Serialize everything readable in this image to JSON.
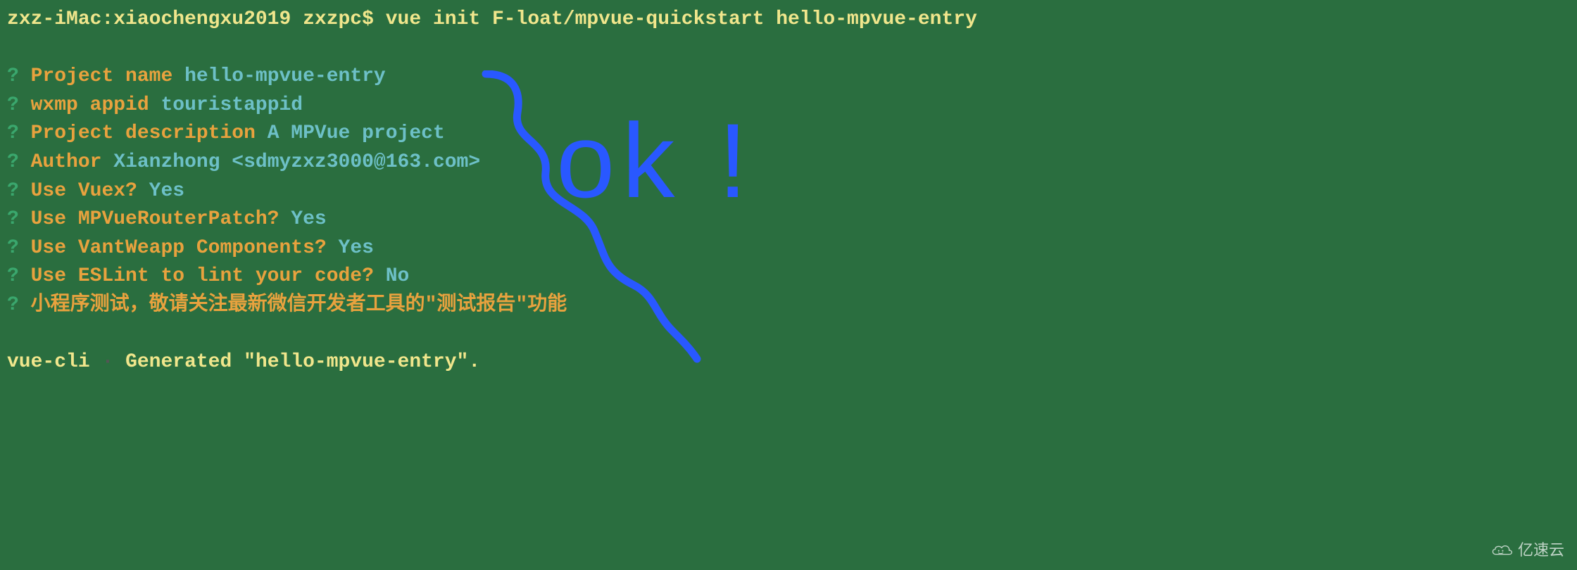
{
  "command": {
    "host": "zxz-iMac",
    "dir": "xiaochengxu2019",
    "user": "zxzpc",
    "symbol": "$",
    "text": "vue init F-loat/mpvue-quickstart hello-mpvue-entry"
  },
  "prompts": [
    {
      "label": "Project name",
      "value": "hello-mpvue-entry"
    },
    {
      "label": "wxmp appid",
      "value": "touristappid"
    },
    {
      "label": "Project description",
      "value": "A MPVue project"
    },
    {
      "label": "Author",
      "value": "Xianzhong <sdmyzxz3000@163.com>"
    },
    {
      "label": "Use Vuex?",
      "value": "Yes"
    },
    {
      "label": "Use MPVueRouterPatch?",
      "value": "Yes"
    },
    {
      "label": "Use VantWeapp Components?",
      "value": "Yes"
    },
    {
      "label": "Use ESLint to lint your code?",
      "value": "No"
    },
    {
      "label": "小程序测试，敬请关注最新微信开发者工具的\"测试报告\"功能",
      "value": ""
    }
  ],
  "result": {
    "tool": "vue-cli",
    "message": "Generated \"hello-mpvue-entry\"."
  },
  "annotation": {
    "text": "ok !"
  },
  "watermark": {
    "text": "亿速云"
  }
}
